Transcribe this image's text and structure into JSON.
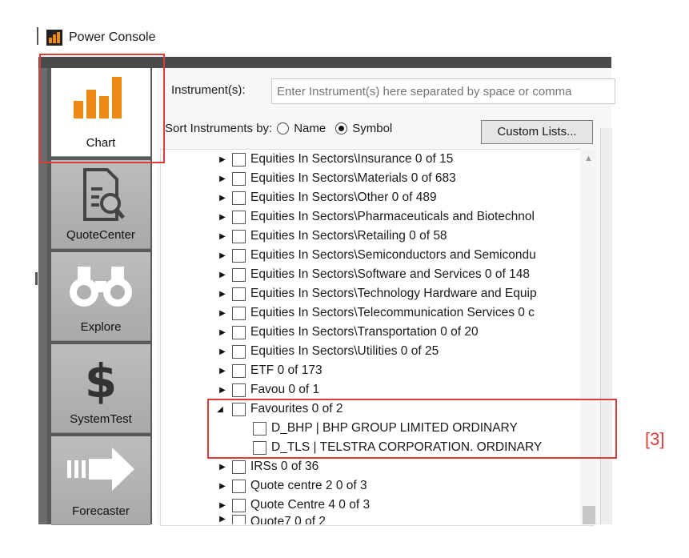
{
  "window": {
    "title": "Power Console"
  },
  "nav": [
    {
      "label": "Chart",
      "icon": "bar-chart-icon",
      "active": true
    },
    {
      "label": "QuoteCenter",
      "icon": "document-search-icon"
    },
    {
      "label": "Explore",
      "icon": "binoculars-icon"
    },
    {
      "label": "SystemTest",
      "icon": "dollar-icon"
    },
    {
      "label": "Forecaster",
      "icon": "arrow-right-icon"
    }
  ],
  "instrument": {
    "label": "Instrument(s):",
    "placeholder": "Enter Instrument(s) here separated by space or comma"
  },
  "sort": {
    "label": "Sort Instruments by:",
    "options": [
      "Name",
      "Symbol"
    ],
    "selected": "Symbol",
    "custom_lists_button": "Custom Lists..."
  },
  "tree": [
    {
      "label": "Equities In Sectors\\Insurance  0 of 15"
    },
    {
      "label": "Equities In Sectors\\Materials  0 of 683"
    },
    {
      "label": "Equities In Sectors\\Other  0 of 489"
    },
    {
      "label": "Equities In Sectors\\Pharmaceuticals and Biotechnol"
    },
    {
      "label": "Equities In Sectors\\Retailing  0 of 58"
    },
    {
      "label": "Equities In Sectors\\Semiconductors and Semicondu"
    },
    {
      "label": "Equities In Sectors\\Software and Services  0 of 148"
    },
    {
      "label": "Equities In Sectors\\Technology Hardware and Equip"
    },
    {
      "label": "Equities In Sectors\\Telecommunication Services  0 c"
    },
    {
      "label": "Equities In Sectors\\Transportation  0 of 20"
    },
    {
      "label": "Equities In Sectors\\Utilities  0 of 25"
    },
    {
      "label": "ETF  0 of 173"
    },
    {
      "label": "Favou  0 of 1"
    },
    {
      "label": "Favourites  0 of 2",
      "expanded": true
    },
    {
      "label": "D_BHP | BHP GROUP LIMITED ORDINARY",
      "child": true
    },
    {
      "label": "D_TLS | TELSTRA CORPORATION. ORDINARY",
      "child": true
    },
    {
      "label": "IRSs  0 of 36"
    },
    {
      "label": "Quote centre 2  0 of 3"
    },
    {
      "label": "Quote Centre 4  0 of 3"
    },
    {
      "label": "Quote7  0 of 2"
    }
  ],
  "annotation": {
    "marker": "[3]",
    "color": "#e03a3a"
  },
  "colors": {
    "accent": "#f08a16",
    "sidebar": "#5a5a5a"
  }
}
